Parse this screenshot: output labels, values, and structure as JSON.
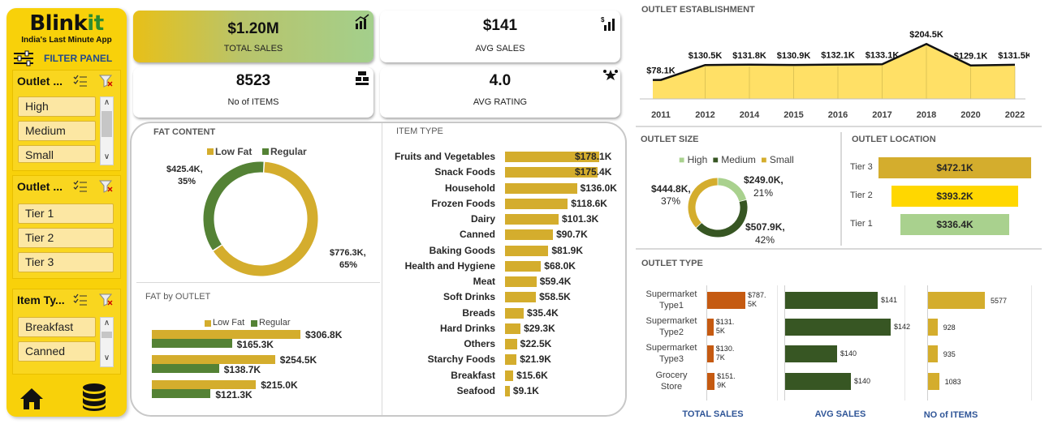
{
  "brand": {
    "logo_main": "Blink",
    "logo_accent": "it",
    "tagline": "India's Last Minute App"
  },
  "filter_panel": {
    "label": "FILTER PANEL",
    "slicers": [
      {
        "title": "Outlet ...",
        "items": [
          "High",
          "Medium",
          "Small"
        ]
      },
      {
        "title": "Outlet ...",
        "items": [
          "Tier 1",
          "Tier 2",
          "Tier 3"
        ]
      },
      {
        "title": "Item Ty...",
        "items": [
          "Breakfast",
          "Canned"
        ]
      }
    ]
  },
  "kpis": {
    "total_sales": {
      "value": "$1.20M",
      "label": "TOTAL SALES"
    },
    "avg_sales": {
      "value": "$141",
      "label": "AVG SALES"
    },
    "no_items": {
      "value": "8523",
      "label": "No of ITEMS"
    },
    "avg_rating": {
      "value": "4.0",
      "label": "AVG RATING"
    }
  },
  "colors": {
    "gold": "#d4ad2d",
    "green": "#548235",
    "dark_green": "#375623",
    "yellow": "#ffd700",
    "light_green": "#a9d18e",
    "orange": "#c55a11",
    "brand_yellow": "#f8d10a"
  },
  "fat_content": {
    "title": "FAT CONTENT",
    "legend": [
      "Low Fat",
      "Regular"
    ],
    "labels": {
      "low_fat": "$776.3K,",
      "low_fat_pct": "65%",
      "regular": "$425.4K,",
      "regular_pct": "35%"
    }
  },
  "fat_by_outlet": {
    "title": "FAT by OUTLET",
    "legend": [
      "Low Fat",
      "Regular"
    ],
    "low_fat_labels": [
      "$306.8K",
      "$254.5K",
      "$215.0K"
    ],
    "regular_labels": [
      "$165.3K",
      "$138.7K",
      "$121.3K"
    ]
  },
  "item_type": {
    "title": "ITEM TYPE",
    "categories": [
      "Fruits and Vegetables",
      "Snack Foods",
      "Household",
      "Frozen Foods",
      "Dairy",
      "Canned",
      "Baking Goods",
      "Health and Hygiene",
      "Meat",
      "Soft Drinks",
      "Breads",
      "Hard Drinks",
      "Others",
      "Starchy Foods",
      "Breakfast",
      "Seafood"
    ],
    "labels": [
      "$178.1K",
      "$175.4K",
      "$136.0K",
      "$118.6K",
      "$101.3K",
      "$90.7K",
      "$81.9K",
      "$68.0K",
      "$59.4K",
      "$58.5K",
      "$35.4K",
      "$29.3K",
      "$22.5K",
      "$21.9K",
      "$15.6K",
      "$9.1K"
    ]
  },
  "establishment": {
    "title": "OUTLET ESTABLISHMENT",
    "years": [
      "2011",
      "2012",
      "2014",
      "2015",
      "2016",
      "2017",
      "2018",
      "2020",
      "2022"
    ],
    "labels": [
      "$78.1K",
      "$130.5K",
      "$131.8K",
      "$130.9K",
      "$132.1K",
      "$133.1K",
      "$204.5K",
      "$129.1K",
      "$131.5K"
    ]
  },
  "outlet_size": {
    "title": "OUTLET SIZE",
    "legend": [
      "High",
      "Medium",
      "Small"
    ],
    "labels": {
      "high": "$249.0K,",
      "high_pct": "21%",
      "medium": "$507.9K,",
      "medium_pct": "42%",
      "small": "$444.8K,",
      "small_pct": "37%"
    }
  },
  "outlet_location": {
    "title": "OUTLET LOCATION",
    "tiers": [
      "Tier 3",
      "Tier 2",
      "Tier 1"
    ],
    "labels": [
      "$472.1K",
      "$393.2K",
      "$336.4K"
    ]
  },
  "outlet_type": {
    "title": "OUTLET TYPE",
    "types": [
      [
        "Supermarket",
        "Type1"
      ],
      [
        "Supermarket",
        "Type2"
      ],
      [
        "Supermarket",
        "Type3"
      ],
      [
        "Grocery",
        "Store"
      ]
    ],
    "sales_labels": [
      [
        "$787.",
        "5K"
      ],
      [
        "$131.",
        "5K"
      ],
      [
        "$130.",
        "7K"
      ],
      [
        "$151.",
        "9K"
      ]
    ],
    "avg_labels": [
      "$141",
      "$142",
      "$140",
      "$140"
    ],
    "item_labels": [
      "5577",
      "928",
      "935",
      "1083"
    ],
    "col_titles": [
      "TOTAL SALES",
      "AVG SALES",
      "NO of ITEMS"
    ]
  },
  "chart_data": [
    {
      "type": "pie",
      "title": "FAT CONTENT",
      "categories": [
        "Low Fat",
        "Regular"
      ],
      "values": [
        776.3,
        425.4
      ],
      "unit": "$K"
    },
    {
      "type": "bar",
      "title": "FAT by OUTLET",
      "categories": [
        "",
        "",
        ""
      ],
      "series": [
        {
          "name": "Low Fat",
          "values": [
            306.8,
            254.5,
            215.0
          ]
        },
        {
          "name": "Regular",
          "values": [
            165.3,
            138.7,
            121.3
          ]
        }
      ],
      "unit": "$K"
    },
    {
      "type": "bar",
      "title": "ITEM TYPE",
      "categories": [
        "Fruits and Vegetables",
        "Snack Foods",
        "Household",
        "Frozen Foods",
        "Dairy",
        "Canned",
        "Baking Goods",
        "Health and Hygiene",
        "Meat",
        "Soft Drinks",
        "Breads",
        "Hard Drinks",
        "Others",
        "Starchy Foods",
        "Breakfast",
        "Seafood"
      ],
      "values": [
        178.1,
        175.4,
        136.0,
        118.6,
        101.3,
        90.7,
        81.9,
        68.0,
        59.4,
        58.5,
        35.4,
        29.3,
        22.5,
        21.9,
        15.6,
        9.1
      ],
      "unit": "$K"
    },
    {
      "type": "area",
      "title": "OUTLET ESTABLISHMENT",
      "x": [
        "2011",
        "2012",
        "2014",
        "2015",
        "2016",
        "2017",
        "2018",
        "2020",
        "2022"
      ],
      "values": [
        78.1,
        130.5,
        131.8,
        130.9,
        132.1,
        133.1,
        204.5,
        129.1,
        131.5
      ],
      "unit": "$K"
    },
    {
      "type": "pie",
      "title": "OUTLET SIZE",
      "categories": [
        "High",
        "Medium",
        "Small"
      ],
      "values": [
        249.0,
        507.9,
        444.8
      ],
      "unit": "$K"
    },
    {
      "type": "bar",
      "title": "OUTLET LOCATION",
      "categories": [
        "Tier 3",
        "Tier 2",
        "Tier 1"
      ],
      "values": [
        472.1,
        393.2,
        336.4
      ],
      "unit": "$K"
    },
    {
      "type": "bar",
      "title": "OUTLET TYPE",
      "categories": [
        "Supermarket Type1",
        "Supermarket Type2",
        "Supermarket Type3",
        "Grocery Store"
      ],
      "series": [
        {
          "name": "TOTAL SALES",
          "values": [
            787.5,
            131.5,
            130.7,
            151.9
          ]
        },
        {
          "name": "AVG SALES",
          "values": [
            141,
            142,
            140,
            140
          ]
        },
        {
          "name": "NO of ITEMS",
          "values": [
            5577,
            928,
            935,
            1083
          ]
        }
      ]
    }
  ]
}
